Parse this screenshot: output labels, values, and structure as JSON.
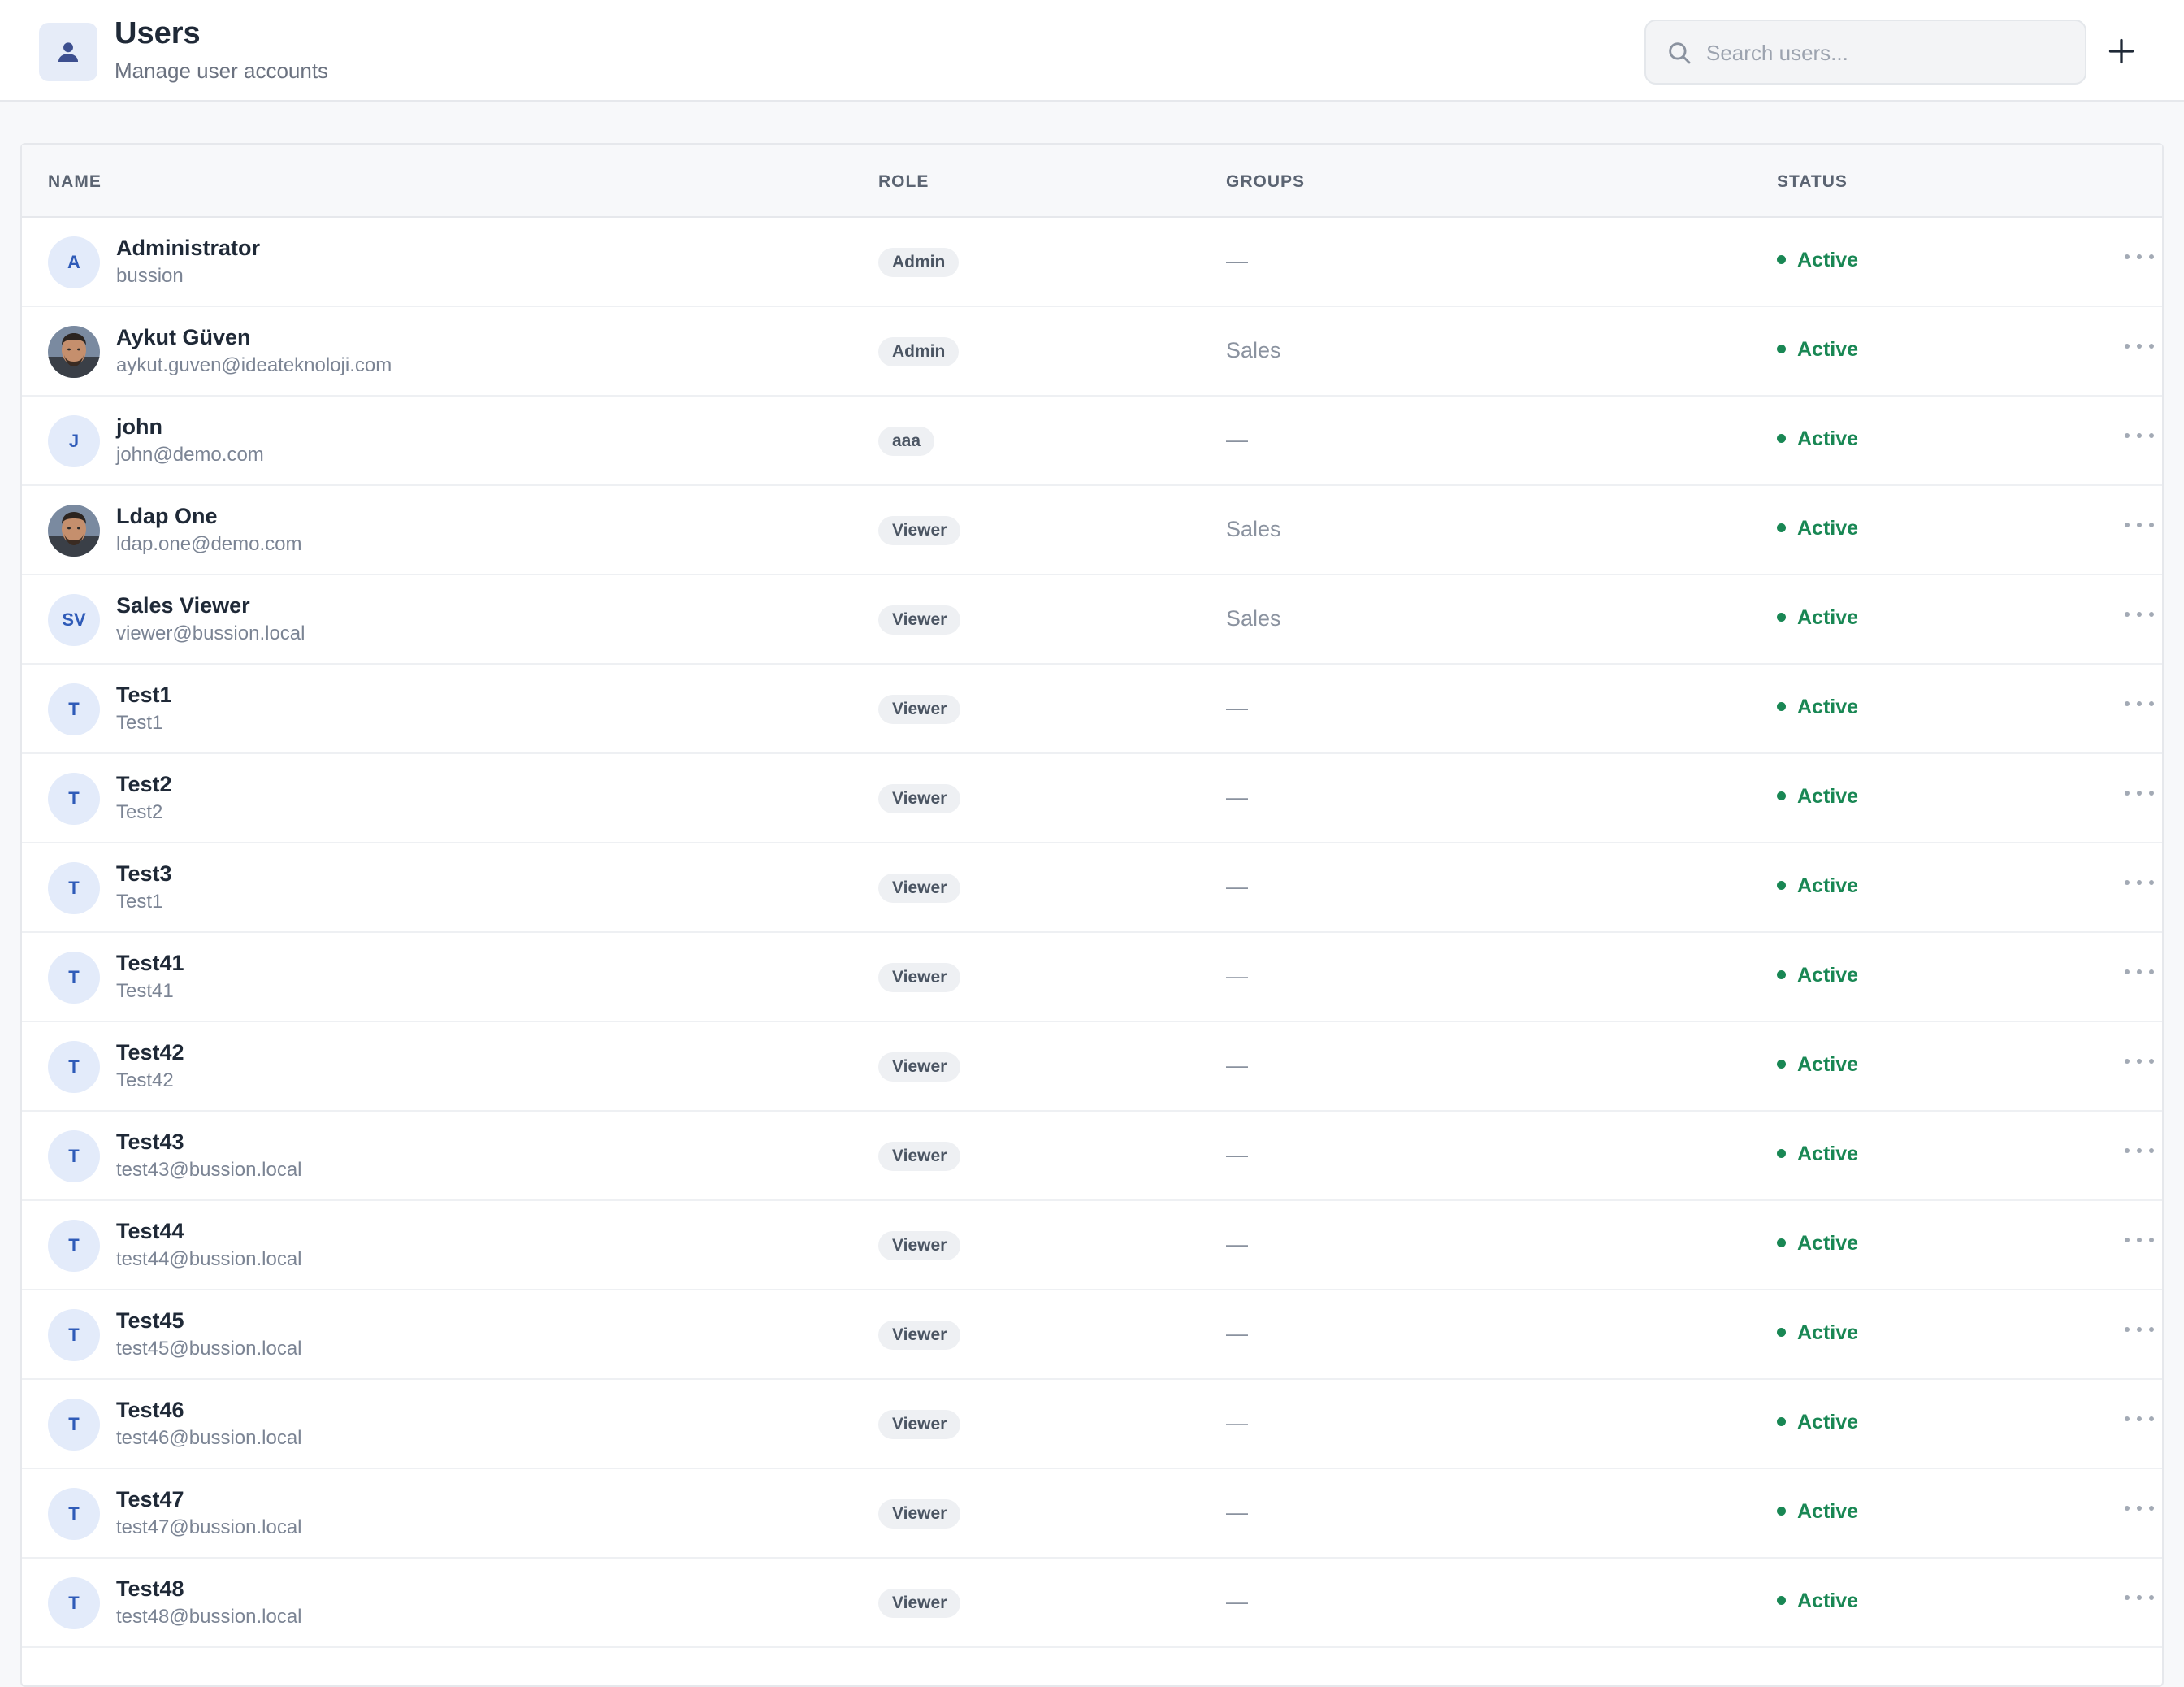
{
  "header": {
    "title": "Users",
    "subtitle": "Manage user accounts",
    "icon": "user-icon",
    "search_placeholder": "Search users...",
    "add_icon": "plus-icon"
  },
  "table": {
    "columns": {
      "name": "NAME",
      "role": "ROLE",
      "groups": "GROUPS",
      "status": "STATUS"
    },
    "rows": [
      {
        "initials": "A",
        "photo": false,
        "name": "Administrator",
        "sub": "bussion",
        "role": "Admin",
        "groups": "—",
        "status": "Active"
      },
      {
        "initials": "",
        "photo": true,
        "name": "Aykut Güven",
        "sub": "aykut.guven@ideateknoloji.com",
        "role": "Admin",
        "groups": "Sales",
        "status": "Active"
      },
      {
        "initials": "J",
        "photo": false,
        "name": "john",
        "sub": "john@demo.com",
        "role": "aaa",
        "groups": "—",
        "status": "Active"
      },
      {
        "initials": "",
        "photo": true,
        "name": "Ldap One",
        "sub": "ldap.one@demo.com",
        "role": "Viewer",
        "groups": "Sales",
        "status": "Active"
      },
      {
        "initials": "SV",
        "photo": false,
        "name": "Sales Viewer",
        "sub": "viewer@bussion.local",
        "role": "Viewer",
        "groups": "Sales",
        "status": "Active"
      },
      {
        "initials": "T",
        "photo": false,
        "name": "Test1",
        "sub": "Test1",
        "role": "Viewer",
        "groups": "—",
        "status": "Active"
      },
      {
        "initials": "T",
        "photo": false,
        "name": "Test2",
        "sub": "Test2",
        "role": "Viewer",
        "groups": "—",
        "status": "Active"
      },
      {
        "initials": "T",
        "photo": false,
        "name": "Test3",
        "sub": "Test1",
        "role": "Viewer",
        "groups": "—",
        "status": "Active"
      },
      {
        "initials": "T",
        "photo": false,
        "name": "Test41",
        "sub": "Test41",
        "role": "Viewer",
        "groups": "—",
        "status": "Active"
      },
      {
        "initials": "T",
        "photo": false,
        "name": "Test42",
        "sub": "Test42",
        "role": "Viewer",
        "groups": "—",
        "status": "Active"
      },
      {
        "initials": "T",
        "photo": false,
        "name": "Test43",
        "sub": "test43@bussion.local",
        "role": "Viewer",
        "groups": "—",
        "status": "Active"
      },
      {
        "initials": "T",
        "photo": false,
        "name": "Test44",
        "sub": "test44@bussion.local",
        "role": "Viewer",
        "groups": "—",
        "status": "Active"
      },
      {
        "initials": "T",
        "photo": false,
        "name": "Test45",
        "sub": "test45@bussion.local",
        "role": "Viewer",
        "groups": "—",
        "status": "Active"
      },
      {
        "initials": "T",
        "photo": false,
        "name": "Test46",
        "sub": "test46@bussion.local",
        "role": "Viewer",
        "groups": "—",
        "status": "Active"
      },
      {
        "initials": "T",
        "photo": false,
        "name": "Test47",
        "sub": "test47@bussion.local",
        "role": "Viewer",
        "groups": "—",
        "status": "Active"
      },
      {
        "initials": "T",
        "photo": false,
        "name": "Test48",
        "sub": "test48@bussion.local",
        "role": "Viewer",
        "groups": "—",
        "status": "Active"
      }
    ]
  },
  "colors": {
    "accent": "#2f5bb8",
    "status_active": "#198754",
    "avatar_bg": "#e3ebfa"
  }
}
